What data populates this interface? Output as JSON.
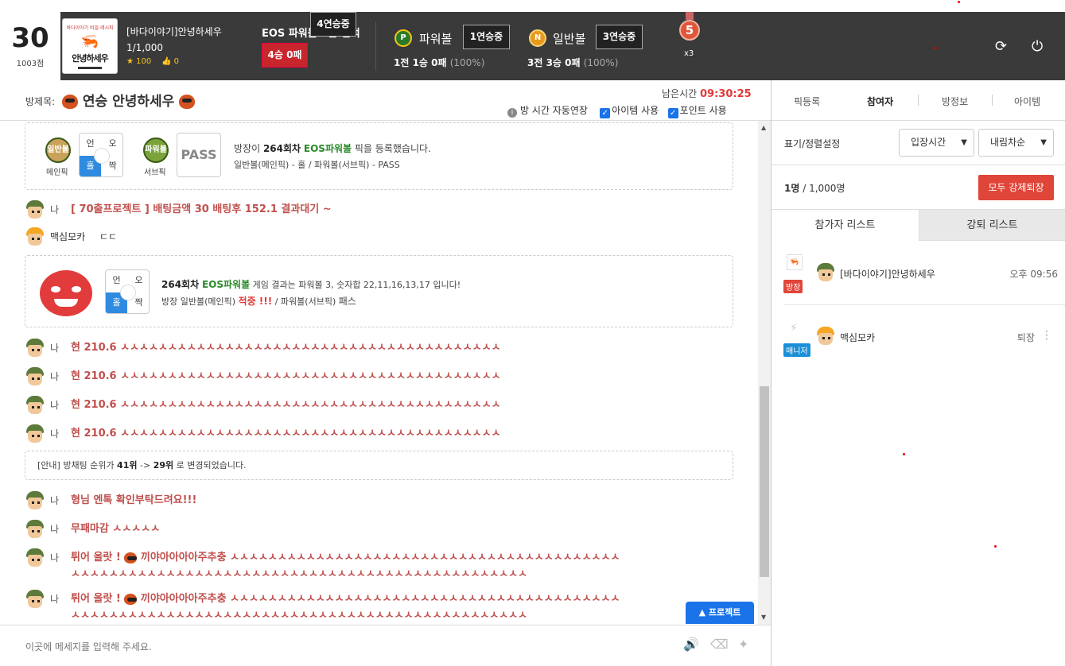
{
  "header": {
    "level": "30",
    "points": "1003점",
    "thumb_top": "바다이야기 비밀 레시피",
    "thumb_name": "안녕하세우",
    "host_name": "[바다이야기]안녕하세우",
    "host_count": "1/1,000",
    "star_count": "100",
    "like_count": "0",
    "eos_title": "EOS 파워볼 5분 전적",
    "eos_record": "4승 0패",
    "eos_streak": "4연승중",
    "powerball_icon": "P",
    "powerball_label": "파워볼",
    "powerball_streak": "1연승중",
    "powerball_record": "1전 1승 0패",
    "powerball_pct": "(100%)",
    "normal_icon": "N",
    "normal_label": "일반볼",
    "normal_streak": "3연승중",
    "normal_record": "3전 3승 0패",
    "normal_pct": "(100%)",
    "medal_number": "5",
    "medal_multiplier": "x3",
    "refresh_icon": "⟳",
    "power_icon": "⏻"
  },
  "subbar": {
    "room_title_label": "방제목:",
    "room_title": "연승 안녕하세우",
    "remaining_label": "남은시간",
    "remaining_time": "09:30:25",
    "auto_extend": "방 시간 자동연장",
    "use_item": "아이템 사용",
    "use_point": "포인트 사용"
  },
  "right_tabs": [
    "픽등록",
    "참여자",
    "방정보",
    "아이템"
  ],
  "chat": {
    "pick_box": {
      "main_pick_icon": "일반볼",
      "main_pick_label": "메인픽",
      "sub_pick_icon": "파워볼",
      "sub_pick_label": "서브픽",
      "oe_q1": "언",
      "oe_q2": "오",
      "oe_q3": "홀",
      "oe_q4": "짝",
      "pass": "PASS",
      "line1_a": "방장이 ",
      "line1_round": "264회차",
      "line1_game": "EOS파워볼",
      "line1_b": " 픽을 등록했습니다.",
      "line2": "일반볼(메인픽) - 홀 / 파워볼(서브픽) - PASS"
    },
    "me": "나",
    "msg1": "[ 70출프로젝트 ] 배팅금액 30 배팅후 152.1 결과대기 ~",
    "user2": "맥심모카",
    "msg2": "ㄷㄷ",
    "result_box": {
      "round": "264회차",
      "game": "EOS파워볼",
      "line1_rest": " 게임 결과는 파워볼 3, 숫자합 22,11,16,13,17 입니다!",
      "line2_a": "방장 일반볼(메인픽) ",
      "hit": "적중 !!!",
      "line2_b": " / 파워볼(서브픽) ",
      "line2_pass": "패스"
    },
    "repeat_msg": "현 210.6 ㅅㅅㅅㅅㅅㅅㅅㅅㅅㅅㅅㅅㅅㅅㅅㅅㅅㅅㅅㅅㅅㅅㅅㅅㅅㅅㅅㅅㅅㅅㅅㅅㅅㅅㅅㅅㅅㅅㅅㅅ",
    "notice_a": "[안내] 방채팅 순위가 ",
    "notice_from": "41위",
    "notice_arrow": " -> ",
    "notice_to": "29위",
    "notice_b": " 로 변경되었습니다.",
    "msg_brother": "형님 엔톡 확인부탁드려요!!!",
    "msg_nofail": "무패마감 ㅅㅅㅅㅅㅅ",
    "msg_jump_a": "튀어 올랏 ! ",
    "msg_jump_b": " 끼야아아아아주추충 ㅅㅅㅅㅅㅅㅅㅅㅅㅅㅅㅅㅅㅅㅅㅅㅅㅅㅅㅅㅅㅅㅅㅅㅅㅅㅅㅅㅅㅅㅅㅅㅅㅅㅅㅅㅅㅅㅅㅅㅅㅅ",
    "msg_jump_line2": "ㅅㅅㅅㅅㅅㅅㅅㅅㅅㅅㅅㅅㅅㅅㅅㅅㅅㅅㅅㅅㅅㅅㅅㅅㅅㅅㅅㅅㅅㅅㅅㅅㅅㅅㅅㅅㅅㅅㅅㅅㅅㅅㅅㅅㅅㅅㅅㅅ",
    "project_button": "▲ 프로젝트"
  },
  "input": {
    "placeholder": "이곳에 메세지를 입력해 주세요."
  },
  "right_panel": {
    "sort_label": "표기/정렬설정",
    "sort_by": "입장시간",
    "sort_order": "내림차순",
    "count_current": "1명",
    "count_sep": " / ",
    "count_max": "1,000명",
    "kick_all": "모두 강제퇴장",
    "tab_participants": "참가자 리스트",
    "tab_kicked": "강퇴 리스트",
    "p1_role": "방장",
    "p1_name": "[바다이야기]안녕하세우",
    "p1_time": "오후 09:56",
    "p2_role": "매니저",
    "p2_name": "맥심모카",
    "p2_action": "퇴장"
  },
  "colors": {
    "header_bg": "#3a3a3a",
    "accent_red": "#c8262c",
    "chat_red": "#c0504d",
    "green": "#2a8a2a",
    "blue": "#1a73e8"
  }
}
